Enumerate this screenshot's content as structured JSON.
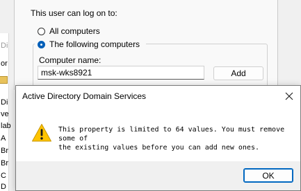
{
  "background_window": {
    "strip_fragments": [
      "Di",
      "or",
      "Di",
      "ve",
      "lab",
      "A",
      "Br",
      "Br",
      "C",
      "D"
    ]
  },
  "logon_dialog": {
    "caption": "This user can log on to:",
    "radio_all": "All computers",
    "radio_following": "The following computers",
    "computer_name_label": "Computer name:",
    "computer_name_value": "msk-wks8921",
    "add_button": "Add"
  },
  "message_box": {
    "title": "Active Directory Domain Services",
    "message_line1": "This property is limited to 64 values. You must remove some of",
    "message_line2": "the existing values before you can add new ones.",
    "ok_button": "OK",
    "icon": "warning-icon",
    "close_icon": "close-icon"
  },
  "colors": {
    "accent": "#0067c0",
    "warning": "#ffc400"
  }
}
